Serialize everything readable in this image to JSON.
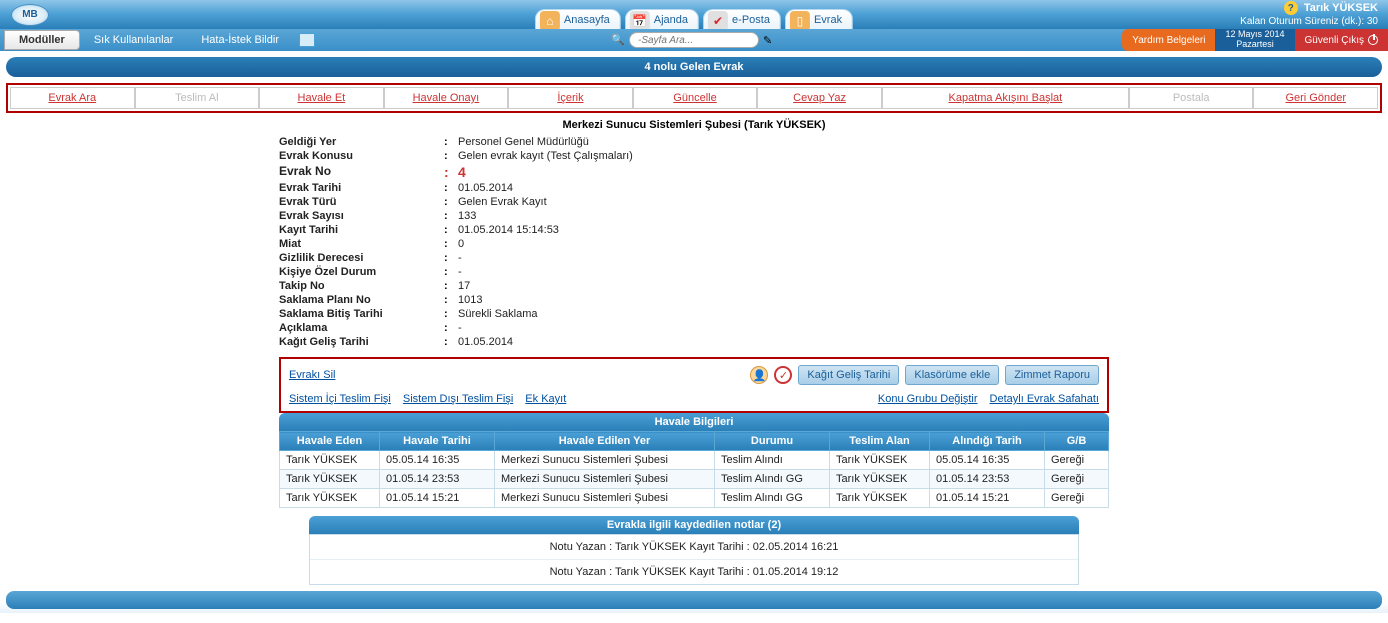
{
  "header": {
    "logo_text": "MB",
    "nav": {
      "home": "Anasayfa",
      "agenda": "Ajanda",
      "mail": "e-Posta",
      "doc": "Evrak"
    },
    "user_name": "Tarık YÜKSEK",
    "session_label": "Kalan Oturum Süreniz (dk.):",
    "session_min": "30"
  },
  "secondbar": {
    "moduller": "Modüller",
    "sik": "Sık Kullanılanlar",
    "hata": "Hata-İstek Bildir",
    "search_placeholder": "-Sayfa Ara...",
    "help": "Yardım Belgeleri",
    "date_line1": "12 Mayıs 2014",
    "date_line2": "Pazartesi",
    "exit": "Güvenli Çıkış"
  },
  "page_title": "4 nolu Gelen Evrak",
  "actions": {
    "evrak_ara": "Evrak Ara",
    "teslim_al": "Teslim Al",
    "havale_et": "Havale Et",
    "havale_onayi": "Havale Onayı",
    "icerik": "İçerik",
    "guncelle": "Güncelle",
    "cevap_yaz": "Cevap Yaz",
    "kapatma": "Kapatma Akışını Başlat",
    "postala": "Postala",
    "geri_gonder": "Geri Gönder"
  },
  "detail": {
    "header": "Merkezi Sunucu Sistemleri Şubesi (Tarık YÜKSEK)",
    "rows": {
      "geldigi_yer_l": "Geldiği Yer",
      "geldigi_yer_v": "Personel Genel Müdürlüğü",
      "evrak_konusu_l": "Evrak Konusu",
      "evrak_konusu_v": "Gelen evrak kayıt (Test Çalışmaları)",
      "evrak_no_l": "Evrak No",
      "evrak_no_v": "4",
      "evrak_tarihi_l": "Evrak Tarihi",
      "evrak_tarihi_v": "01.05.2014",
      "evrak_turu_l": "Evrak Türü",
      "evrak_turu_v": "Gelen Evrak Kayıt",
      "evrak_sayisi_l": "Evrak Sayısı",
      "evrak_sayisi_v": "133",
      "kayit_tarihi_l": "Kayıt Tarihi",
      "kayit_tarihi_v": "01.05.2014 15:14:53",
      "miat_l": "Miat",
      "miat_v": "0",
      "gizlilik_l": "Gizlilik Derecesi",
      "gizlilik_v": "-",
      "kisiye_l": "Kişiye Özel Durum",
      "kisiye_v": "-",
      "takip_l": "Takip No",
      "takip_v": "17",
      "saklama_plan_l": "Saklama Planı No",
      "saklama_plan_v": "1013",
      "saklama_bitis_l": "Saklama Bitiş Tarihi",
      "saklama_bitis_v": "Sürekli Saklama",
      "aciklama_l": "Açıklama",
      "aciklama_v": "-",
      "kagit_gelis_l": "Kağıt Geliş Tarihi",
      "kagit_gelis_v": "01.05.2014"
    }
  },
  "midbox": {
    "evraki_sil": "Evrakı Sil",
    "sistem_ici": "Sistem İçi Teslim Fişi",
    "sistem_disi": "Sistem Dışı Teslim Fişi",
    "ek_kayit": "Ek Kayıt",
    "kagit_gelis_btn": "Kağıt Geliş Tarihi",
    "klasorume": "Klasörüme ekle",
    "zimmet": "Zimmet Raporu",
    "konu_grubu": "Konu Grubu Değiştir",
    "detayli": "Detaylı Evrak Safahatı"
  },
  "havale": {
    "title": "Havale Bilgileri",
    "cols": {
      "eden": "Havale Eden",
      "tarih": "Havale Tarihi",
      "yer": "Havale Edilen Yer",
      "durum": "Durumu",
      "alan": "Teslim Alan",
      "alindigi": "Alındığı Tarih",
      "gb": "G/B"
    },
    "rows": [
      {
        "eden": "Tarık YÜKSEK",
        "tarih": "05.05.14 16:35",
        "yer": "Merkezi Sunucu Sistemleri Şubesi",
        "durum": "Teslim Alındı",
        "alan": "Tarık YÜKSEK",
        "alindigi": "05.05.14 16:35",
        "gb": "Gereği"
      },
      {
        "eden": "Tarık YÜKSEK",
        "tarih": "01.05.14 23:53",
        "yer": "Merkezi Sunucu Sistemleri Şubesi",
        "durum": "Teslim Alındı GG",
        "alan": "Tarık YÜKSEK",
        "alindigi": "01.05.14 23:53",
        "gb": "Gereği"
      },
      {
        "eden": "Tarık YÜKSEK",
        "tarih": "01.05.14 15:21",
        "yer": "Merkezi Sunucu Sistemleri Şubesi",
        "durum": "Teslim Alındı GG",
        "alan": "Tarık YÜKSEK",
        "alindigi": "01.05.14 15:21",
        "gb": "Gereği"
      }
    ]
  },
  "notes": {
    "title": "Evrakla ilgili kaydedilen notlar (2)",
    "items": [
      "Notu Yazan : Tarık YÜKSEK   Kayıt Tarihi : 02.05.2014 16:21",
      "Notu Yazan : Tarık YÜKSEK   Kayıt Tarihi : 01.05.2014 19:12"
    ]
  }
}
